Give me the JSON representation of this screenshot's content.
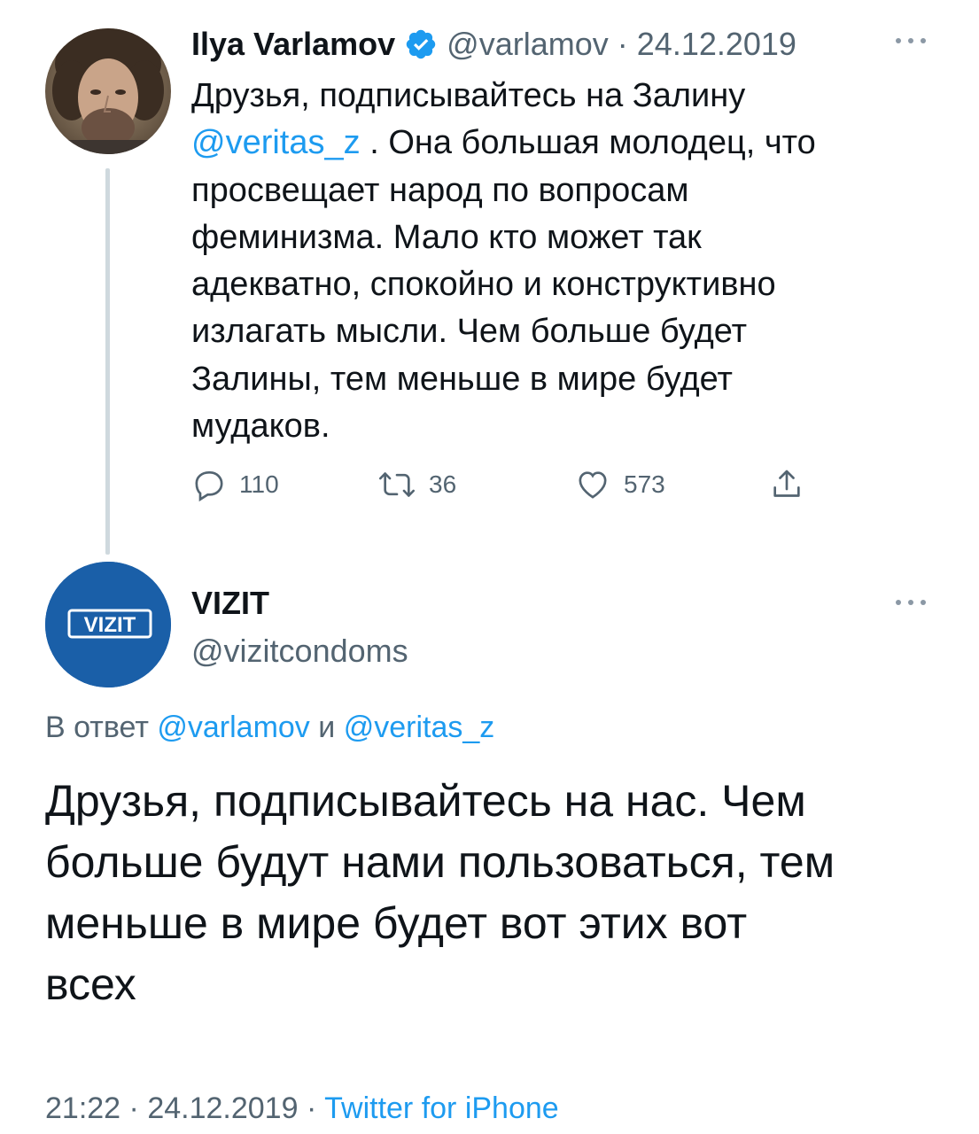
{
  "parent_tweet": {
    "display_name": "Ilya Varlamov",
    "handle": "@varlamov",
    "separator": "·",
    "date": "24.12.2019",
    "text_lines": [
      "Друзья, подписывайтесь на Залину",
      ". Она большая молодец, что",
      "просвещает народ по вопросам",
      "феминизма. Мало кто может так",
      "адекватно, спокойно и конструктивно",
      "излагать мысли. Чем больше будет",
      "Залины, тем меньше в мире будет",
      "мудаков."
    ],
    "mention": "@veritas_z",
    "replies_count": "110",
    "retweets_count": "36",
    "likes_count": "573"
  },
  "reply_tweet": {
    "display_name": "VIZIT",
    "handle": "@vizitcondoms",
    "avatar_logo_text": "VIZIT",
    "replying_prefix": "В ответ",
    "replying_mention_1": "@varlamov",
    "replying_conjunction": "и",
    "replying_mention_2": "@veritas_z",
    "text_lines": [
      "Друзья, подписывайтесь на нас. Чем",
      "больше будут нами пользоваться, тем",
      "меньше в мире будет вот этих вот",
      "всех"
    ],
    "time": "21:22",
    "separator": "·",
    "date": "24.12.2019",
    "source": "Twitter for iPhone"
  },
  "icons": {
    "verified": "verified-badge-icon",
    "more": "more-options-icon",
    "reply": "reply-icon",
    "retweet": "retweet-icon",
    "like": "heart-icon",
    "share": "share-icon"
  },
  "colors": {
    "link": "#1d9bf0",
    "secondary_text": "#536471",
    "primary_text": "#0f1419",
    "vizit_brand": "#1a5fa8"
  }
}
